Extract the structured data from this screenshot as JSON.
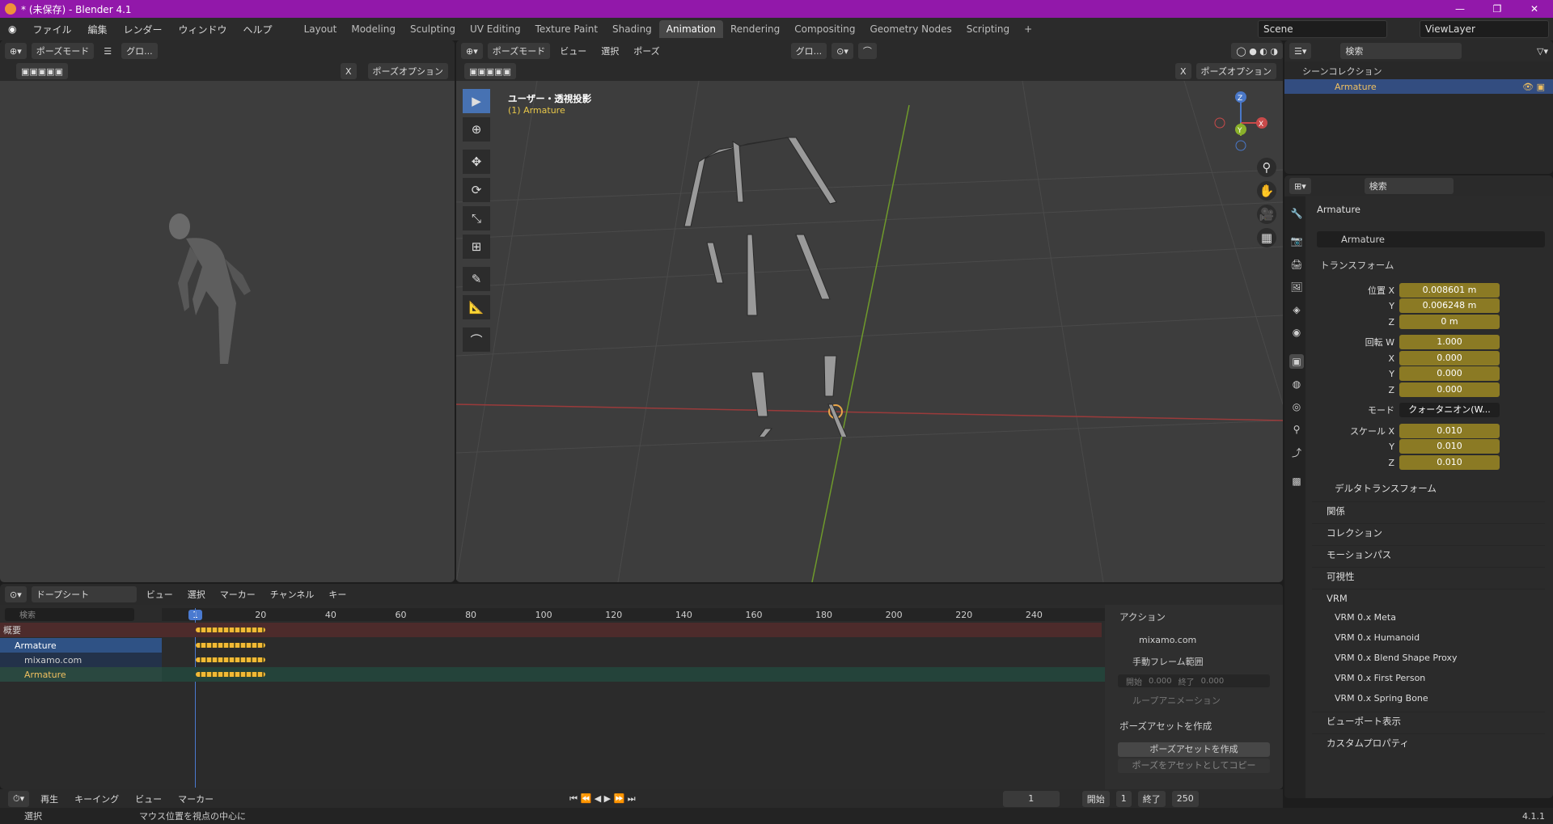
{
  "title": "* (未保存) - Blender 4.1",
  "menus": [
    "ファイル",
    "編集",
    "レンダー",
    "ウィンドウ",
    "ヘルプ"
  ],
  "workspaces": [
    "Layout",
    "Modeling",
    "Sculpting",
    "UV Editing",
    "Texture Paint",
    "Shading",
    "Animation",
    "Rendering",
    "Compositing",
    "Geometry Nodes",
    "Scripting"
  ],
  "active_workspace": "Animation",
  "scene": "Scene",
  "view_layer": "ViewLayer",
  "left_view": {
    "mode": "ポーズモード",
    "transform": "グロ...",
    "options": "ポーズオプション",
    "x_label": "X"
  },
  "viewport": {
    "mode": "ポーズモード",
    "view": "ビュー",
    "select": "選択",
    "pose": "ポーズ",
    "transform": "グロ...",
    "options": "ポーズオプション",
    "x_label": "X",
    "title": "ユーザー・透視投影",
    "subtitle": "(1) Armature",
    "axis_x": "X",
    "axis_y": "Y",
    "axis_z": "Z"
  },
  "outliner": {
    "search": "検索",
    "collection": "シーンコレクション",
    "item": "Armature"
  },
  "properties": {
    "search": "検索",
    "object": "Armature",
    "data": "Armature",
    "transform": "トランスフォーム",
    "fields": [
      [
        "位置 X",
        "0.008601 m"
      ],
      [
        "Y",
        "0.006248 m"
      ],
      [
        "Z",
        "0 m"
      ],
      [
        "回転 W",
        "1.000"
      ],
      [
        "X",
        "0.000"
      ],
      [
        "Y",
        "0.000"
      ],
      [
        "Z",
        "0.000"
      ]
    ],
    "mode_label": "モード",
    "mode_value": "クォータニオン(W...",
    "scale": [
      [
        "スケール X",
        "0.010"
      ],
      [
        "Y",
        "0.010"
      ],
      [
        "Z",
        "0.010"
      ]
    ],
    "delta": "デルタトランスフォーム",
    "sections": [
      "関係",
      "コレクション",
      "モーションパス",
      "可視性"
    ],
    "vrm": "VRM",
    "vrm_items": [
      "VRM 0.x Meta",
      "VRM 0.x Humanoid",
      "VRM 0.x Blend Shape Proxy",
      "VRM 0.x First Person",
      "VRM 0.x Spring Bone"
    ],
    "sections2": [
      "ビューポート表示",
      "カスタムプロパティ"
    ]
  },
  "dopesheet": {
    "mode": "ドープシート",
    "menus": [
      "ビュー",
      "選択",
      "マーカー",
      "チャンネル",
      "キー"
    ],
    "search": "検索",
    "frames": [
      "1",
      "20",
      "40",
      "60",
      "80",
      "100",
      "120",
      "140",
      "160",
      "180",
      "200",
      "220",
      "240"
    ],
    "channels": [
      "概要",
      "Armature",
      "mixamo.com",
      "Armature"
    ],
    "action": {
      "header": "アクション",
      "name": "mixamo.com",
      "manual": "手動フレーム範囲",
      "start": "開始",
      "start_val": "0.000",
      "end": "終了",
      "end_val": "0.000",
      "loop": "ループアニメーション"
    },
    "pose": {
      "header": "ポーズアセットを作成",
      "btn": "ポーズアセットを作成",
      "copy": "ポーズをアセットとしてコピー"
    }
  },
  "timeline": {
    "play": "再生",
    "keying": "キーイング",
    "view": "ビュー",
    "marker": "マーカー",
    "frame": "1",
    "start_label": "開始",
    "start": "1",
    "end_label": "終了",
    "end": "250"
  },
  "status": {
    "select": "選択",
    "center": "マウス位置を視点の中心に",
    "version": "4.1.1"
  }
}
